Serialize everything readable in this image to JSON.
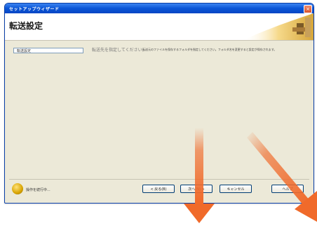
{
  "window": {
    "title": "セットアップウィザード",
    "close_label": "×"
  },
  "header": {
    "title": "転送設定"
  },
  "panel": {
    "field_value": "転送設定",
    "description_main": "転送先を指定してください。",
    "description_small": "転送元のファイルを保存するフォルダを指定してください。フォルダ名を変更すると設定が保存されます。"
  },
  "footer": {
    "status_text": "操作を続行中...",
    "back_label": "< 戻る(B)",
    "next_label": "次へ(N) >",
    "cancel_label": "キャンセル",
    "help_label": "ヘルプ"
  },
  "annotations": {
    "arrow_color": "#f06a2a"
  }
}
